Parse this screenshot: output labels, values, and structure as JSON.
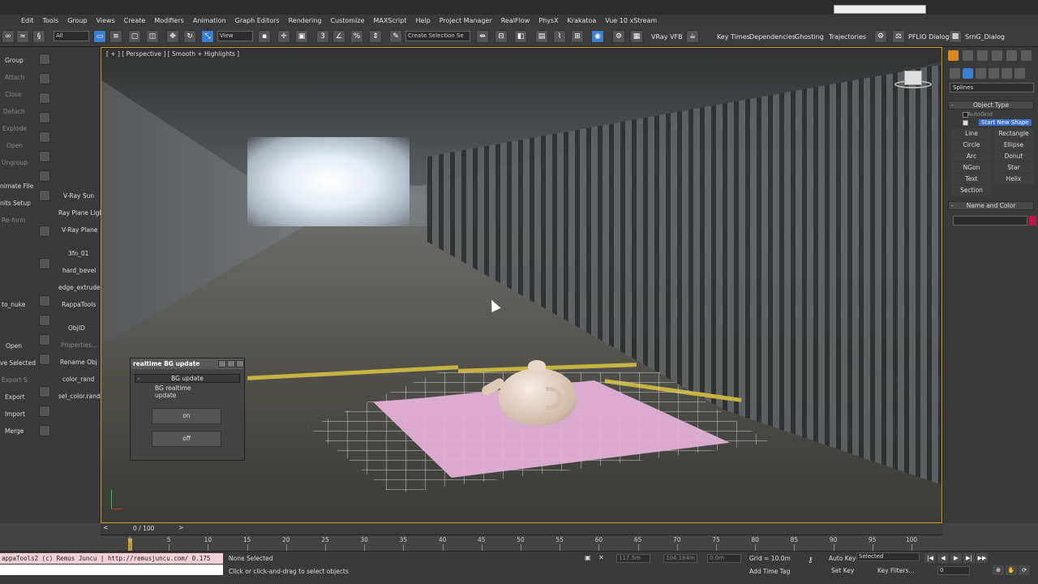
{
  "menu": [
    "Edit",
    "Tools",
    "Group",
    "Views",
    "Create",
    "Modifiers",
    "Animation",
    "Graph Editors",
    "Rendering",
    "Customize",
    "MAXScript",
    "Help",
    "Project Manager",
    "RealFlow",
    "PhysX",
    "Krakatoa",
    "Vue 10 xStream"
  ],
  "toolbar": {
    "selection_filter": "All",
    "reference_coord": "View",
    "named_selection": "Create Selection Se",
    "vray_vfb": "VRay VFB",
    "key_times": "Key Times",
    "dependencies": "Dependencies",
    "ghosting": "Ghosting",
    "trajectories": "Trajectories",
    "pflo_dialog": "PFLIO Dialog",
    "srng_dialog": "SrnG_Dialog"
  },
  "left_panel": {
    "col1": [
      "Group",
      "Attach",
      "Close",
      "Detach",
      "Explode",
      "Open",
      "Ungroup",
      "nimate File",
      "nits Setup",
      "Re-form",
      "to_nuke",
      "Open",
      "ve Selected",
      "Export S",
      "Export",
      "Import",
      "Merge"
    ],
    "col3": [
      "V-Ray Sun",
      "Ray Plane Ligl",
      "V-Ray Plane",
      "3fn_01",
      "hard_bevel",
      "edge_extrude",
      "RappaTools",
      "ObjID",
      "Properties...",
      "Rename Obj",
      "color_rand",
      "sel_color.rand"
    ]
  },
  "viewport": {
    "label": "[ + ] [ Perspective ] [ Smooth + Highlights ]"
  },
  "dialog": {
    "title": "realtime BG update",
    "group": "BG update",
    "text": "BG realtime update",
    "on_label": "on",
    "off_label": "off"
  },
  "right_panel": {
    "category": "Splines",
    "object_type_title": "Object Type",
    "autogrid": "AutoGrid",
    "start_new_shape": "Start New Shape",
    "buttons": [
      "Line",
      "Rectangle",
      "Circle",
      "Ellipse",
      "Arc",
      "Donut",
      "NGon",
      "Star",
      "Text",
      "Helix",
      "Section"
    ],
    "name_color_title": "Name and Color",
    "swatch_color": "#c0184a"
  },
  "timeline": {
    "counter": "0 / 100",
    "ticks": [
      "0",
      "5",
      "10",
      "15",
      "20",
      "25",
      "30",
      "35",
      "40",
      "45",
      "50",
      "55",
      "60",
      "65",
      "70",
      "75",
      "80",
      "85",
      "90",
      "95",
      "100"
    ]
  },
  "status": {
    "maxscript": "appaTools2 (c) Remus Juncu | http://remusjuncu.com/ 0.175",
    "selection": "None Selected",
    "prompt": "Click or click-and-drag to select objects",
    "x_field": "117.5m",
    "y_field": "104.184m",
    "z_field": "0.0m",
    "grid": "Grid = 10.0m",
    "auto_key": "Auto Key",
    "set_key": "Set Key",
    "selected_dropdown": "Selected",
    "key_filters": "Key Filters...",
    "add_time_tag": "Add Time Tag",
    "frame_field": "0"
  }
}
